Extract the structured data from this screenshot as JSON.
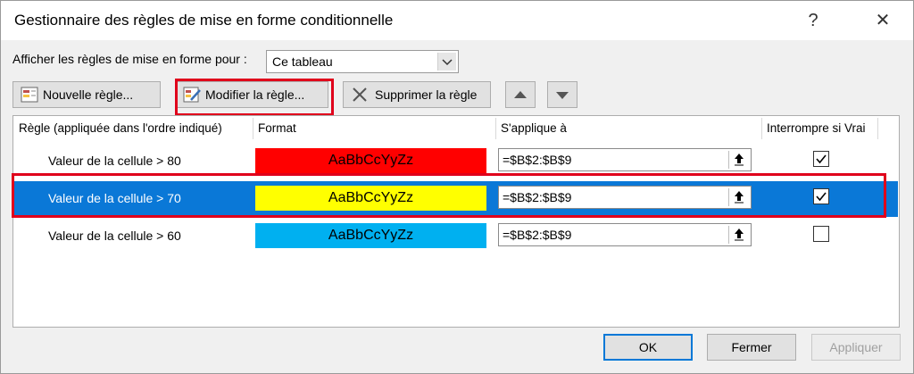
{
  "window": {
    "title": "Gestionnaire des règles de mise en forme conditionnelle",
    "help_glyph": "?",
    "close_glyph": "✕"
  },
  "show_rules": {
    "label": "Afficher les règles de mise en forme pour :",
    "selected": "Ce tableau"
  },
  "toolbar": {
    "new_rule": "Nouvelle règle...",
    "edit_rule": "Modifier la règle...",
    "delete_rule": "Supprimer la règle",
    "move_up_icon": "triangle-up-icon",
    "move_down_icon": "triangle-down-icon"
  },
  "table": {
    "headers": {
      "rule": "Règle (appliquée dans l'ordre indiqué)",
      "format": "Format",
      "applies_to": "S'applique à",
      "stop_if_true": "Interrompre si Vrai"
    },
    "rows": [
      {
        "rule": "Valeur de la cellule > 80",
        "preview": "AaBbCcYyZz",
        "fill": "#ff0000",
        "applies_to": "=$B$2:$B$9",
        "stop_if_true": true,
        "selected": false
      },
      {
        "rule": "Valeur de la cellule > 70",
        "preview": "AaBbCcYyZz",
        "fill": "#ffff00",
        "applies_to": "=$B$2:$B$9",
        "stop_if_true": true,
        "selected": true
      },
      {
        "rule": "Valeur de la cellule > 60",
        "preview": "AaBbCcYyZz",
        "fill": "#00b0f0",
        "applies_to": "=$B$2:$B$9",
        "stop_if_true": false,
        "selected": false
      }
    ]
  },
  "footer": {
    "ok": "OK",
    "close": "Fermer",
    "apply": "Appliquer"
  },
  "colors": {
    "selection": "#0a78d7",
    "highlight_box": "#e0001b"
  }
}
